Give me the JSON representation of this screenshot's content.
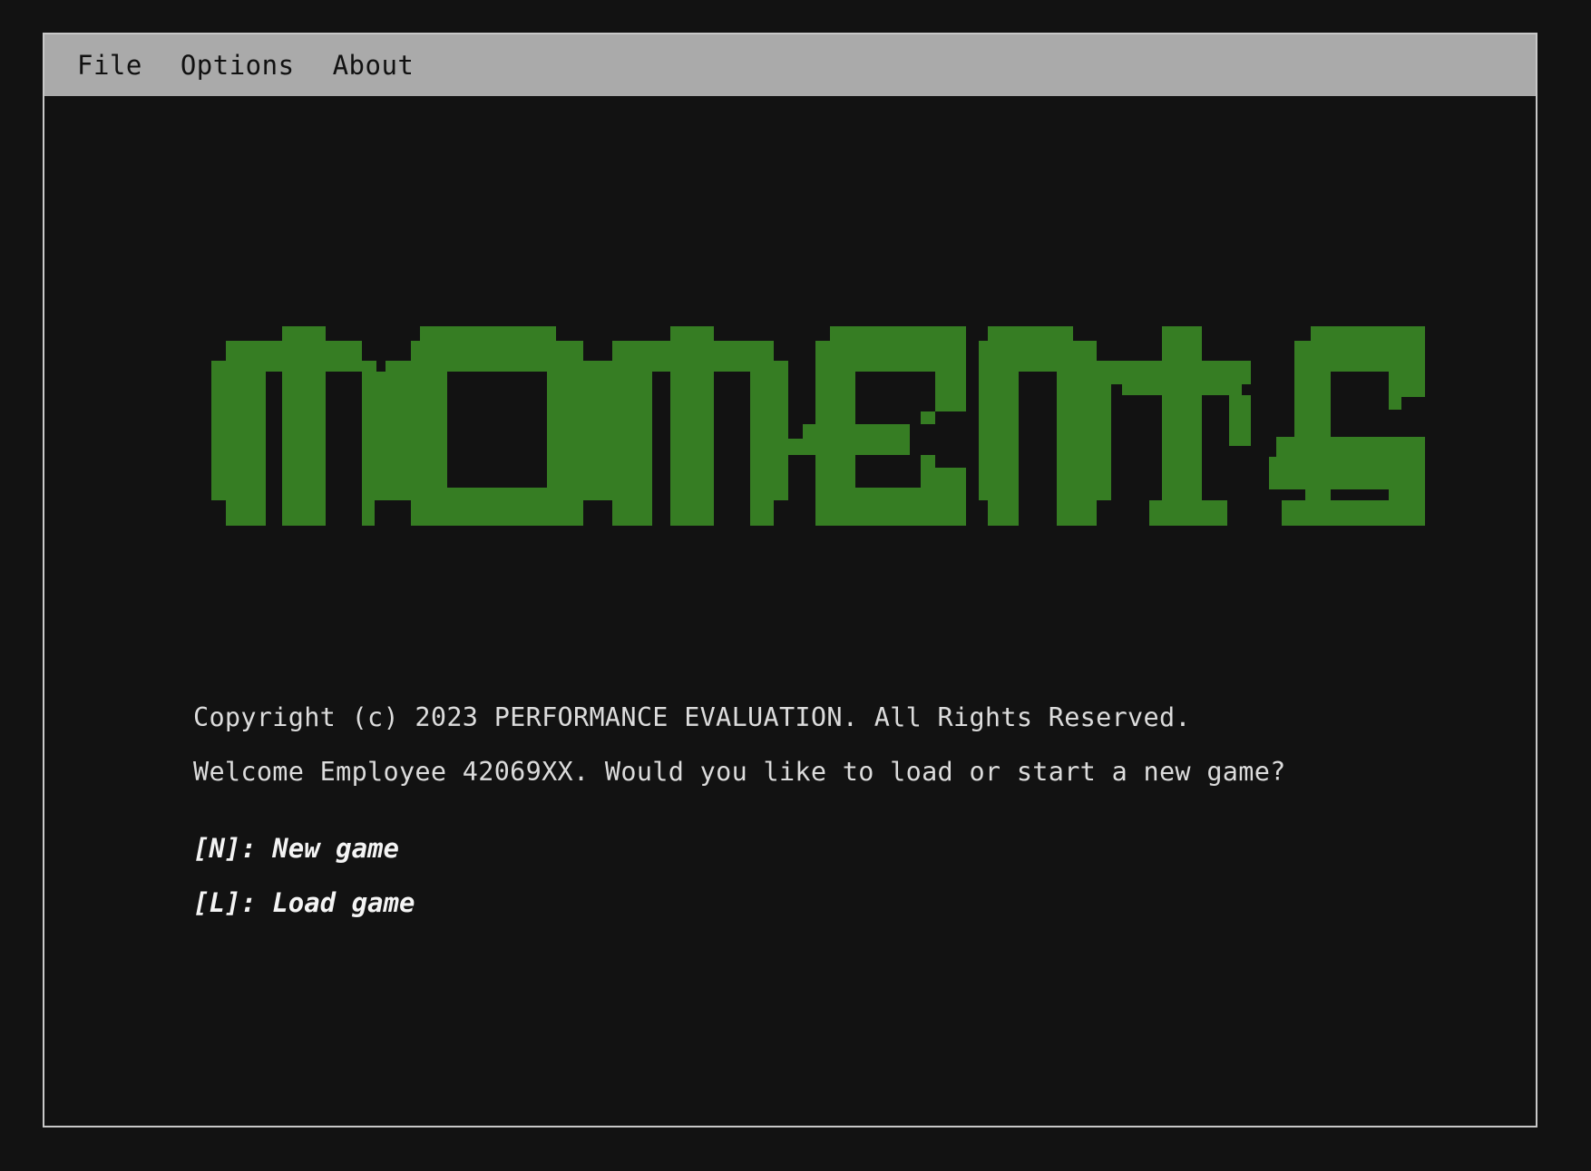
{
  "menu": {
    "items": [
      {
        "label": "File"
      },
      {
        "label": "Options"
      },
      {
        "label": "About"
      }
    ]
  },
  "logo": {
    "text": "moments",
    "color": "#367d23"
  },
  "intro": {
    "copyright": "Copyright (c) 2023 PERFORMANCE EVALUATION. All Rights Reserved.",
    "welcome": "Welcome Employee 42069XX. Would you like to load or start a new game?"
  },
  "options": [
    {
      "label": "[N]: New game"
    },
    {
      "label": "[L]: Load game"
    }
  ],
  "colors": {
    "background": "#121212",
    "menubar": "#aaaaaa",
    "window_border": "#c8c8c8",
    "text": "#dcdcdc",
    "option_text": "#f4f4f4"
  }
}
